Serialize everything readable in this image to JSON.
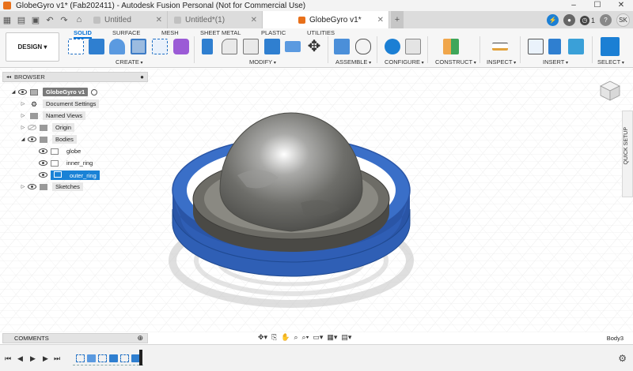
{
  "window": {
    "title": "GlobeGyro v1* (Fab202411) - Autodesk Fusion Personal (Not for Commercial Use)",
    "controls": [
      "–",
      "☐",
      "✕"
    ]
  },
  "tabs": [
    {
      "label": "Untitled",
      "active": false
    },
    {
      "label": "Untitled*(1)",
      "active": false
    },
    {
      "label": "GlobeGyro v1*",
      "active": true
    }
  ],
  "status": {
    "job_count": "1",
    "user_initials": "SK"
  },
  "workspace": {
    "mode_button": "DESIGN ▾",
    "tabs": [
      "SOLID",
      "SURFACE",
      "MESH",
      "SHEET METAL",
      "PLASTIC",
      "UTILITIES"
    ],
    "active_tab": "SOLID"
  },
  "toolbar_groups": [
    {
      "label": "CREATE"
    },
    {
      "label": "MODIFY"
    },
    {
      "label": "ASSEMBLE"
    },
    {
      "label": "CONFIGURE"
    },
    {
      "label": "CONSTRUCT"
    },
    {
      "label": "INSPECT"
    },
    {
      "label": "INSERT"
    },
    {
      "label": "SELECT"
    }
  ],
  "browser": {
    "title": "BROWSER",
    "items": [
      {
        "label": "GlobeGyro v1",
        "icon": "component-icon"
      },
      {
        "label": "Document Settings",
        "icon": "gear-icon"
      },
      {
        "label": "Named Views",
        "icon": "folder-icon"
      },
      {
        "label": "Origin",
        "icon": "folder-icon"
      },
      {
        "label": "Bodies",
        "icon": "folder-icon"
      },
      {
        "label": "globe",
        "icon": "body-icon"
      },
      {
        "label": "inner_ring",
        "icon": "body-icon"
      },
      {
        "label": "outer_ring",
        "icon": "body-icon",
        "selected": true
      },
      {
        "label": "Sketches",
        "icon": "folder-icon"
      }
    ]
  },
  "quick_setup": "QUICK SETUP",
  "comments": {
    "title": "COMMENTS"
  },
  "footer": {
    "body_label": "Body3"
  },
  "colors": {
    "accent": "#0673d8",
    "outer_ring": "#2f5fb5",
    "inner_ring": "#5a5a56",
    "globe": "#8a8a88",
    "selection": "#1a82d6"
  }
}
